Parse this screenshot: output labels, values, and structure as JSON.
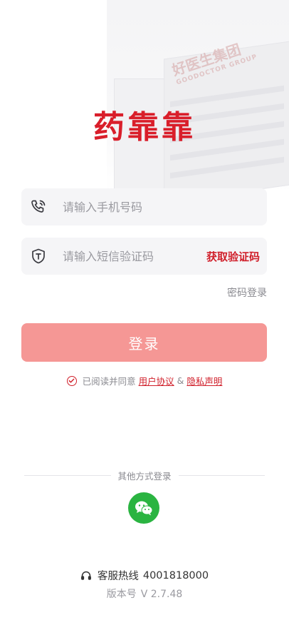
{
  "brand": {
    "name": "药靠靠"
  },
  "backdrop": {
    "sign_text": "好医生集团",
    "sign_subtext": "GOODOCTOR GROUP"
  },
  "form": {
    "phone_placeholder": "请输入手机号码",
    "code_placeholder": "请输入短信验证码",
    "get_code_label": "获取验证码",
    "password_login_label": "密码登录",
    "login_button_label": "登录"
  },
  "agreement": {
    "prefix": "已阅读并同意",
    "user_agreement": "用户协议",
    "amp": "&",
    "privacy": "隐私声明"
  },
  "other_login": {
    "label": "其他方式登录",
    "icon": "wechat-icon"
  },
  "footer": {
    "hotline_label": "客服热线",
    "hotline_number": "4001818000",
    "version_label": "版本号",
    "version_value": "V 2.7.48"
  },
  "colors": {
    "accent": "#d01f2a",
    "button": "#f59795",
    "wechat": "#2ab441"
  }
}
